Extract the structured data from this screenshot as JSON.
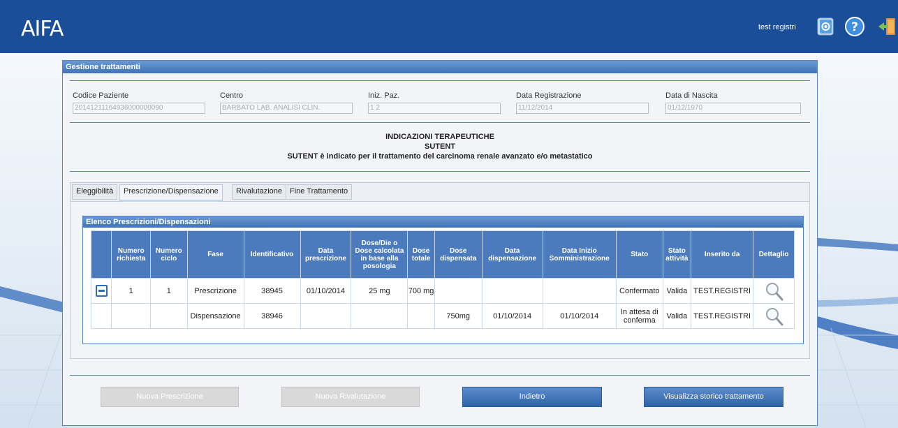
{
  "header": {
    "logo": "AIFA",
    "user": "test registri"
  },
  "panel": {
    "title": "Gestione trattamenti",
    "fields": [
      {
        "label": "Codice Paziente",
        "value": "20141211164936000000090"
      },
      {
        "label": "Centro",
        "value": "BARBATO LAB. ANALISI CLIN."
      },
      {
        "label": "Iniz. Paz.",
        "value": "1 2"
      },
      {
        "label": "Data Registrazione",
        "value": "11/12/2014"
      },
      {
        "label": "Data di Nascita",
        "value": "01/12/1970"
      }
    ],
    "indications": {
      "title": "INDICAZIONI TERAPEUTICHE",
      "drug": "SUTENT",
      "text": "SUTENT è indicato per il trattamento del carcinoma renale avanzato e/o metastatico"
    }
  },
  "tabs": [
    {
      "label": "Eleggibilità"
    },
    {
      "label": "Prescrizione/Dispensazione"
    },
    {
      "label": "Rivalutazione"
    },
    {
      "label": "Fine Trattamento"
    }
  ],
  "list": {
    "title": "Elenco Prescrizioni/Dispensazioni",
    "headers": [
      "",
      "Numero richiesta",
      "Numero ciclo",
      "Fase",
      "Identificativo",
      "Data prescrizione",
      "Dose/Die o Dose calcolata in base alla posologia",
      "Dose totale",
      "Dose dispensata",
      "Data dispensazione",
      "Data Inizio Somministrazione",
      "Stato",
      "Stato attività",
      "Inserito da",
      "Dettaglio"
    ],
    "rows": [
      {
        "richiesta": "1",
        "ciclo": "1",
        "fase": "Prescrizione",
        "id": "38945",
        "data_prescrizione": "01/10/2014",
        "dose_die": "25 mg",
        "dose_totale": "700 mg",
        "dose_dispensata": "",
        "data_dispensazione": "",
        "data_inizio": "",
        "stato": "Confermato",
        "stato_attivita": "Valida",
        "inserito_da": "TEST.REGISTRI"
      },
      {
        "richiesta": "",
        "ciclo": "",
        "fase": "Dispensazione",
        "id": "38946",
        "data_prescrizione": "",
        "dose_die": "",
        "dose_totale": "",
        "dose_dispensata": "750mg",
        "data_dispensazione": "01/10/2014",
        "data_inizio": "01/10/2014",
        "stato": "In attesa di conferma",
        "stato_attivita": "Valida",
        "inserito_da": "TEST.REGISTRI"
      }
    ]
  },
  "buttons": {
    "nuova_prescrizione": "Nuova Prescrizione",
    "nuova_rivalutazione": "Nuova Rivalutazione",
    "indietro": "Indietro",
    "storico": "Visualizza storico trattamento"
  },
  "colors": {
    "header": "#1b4e99",
    "accent": "#4b7bbd"
  }
}
